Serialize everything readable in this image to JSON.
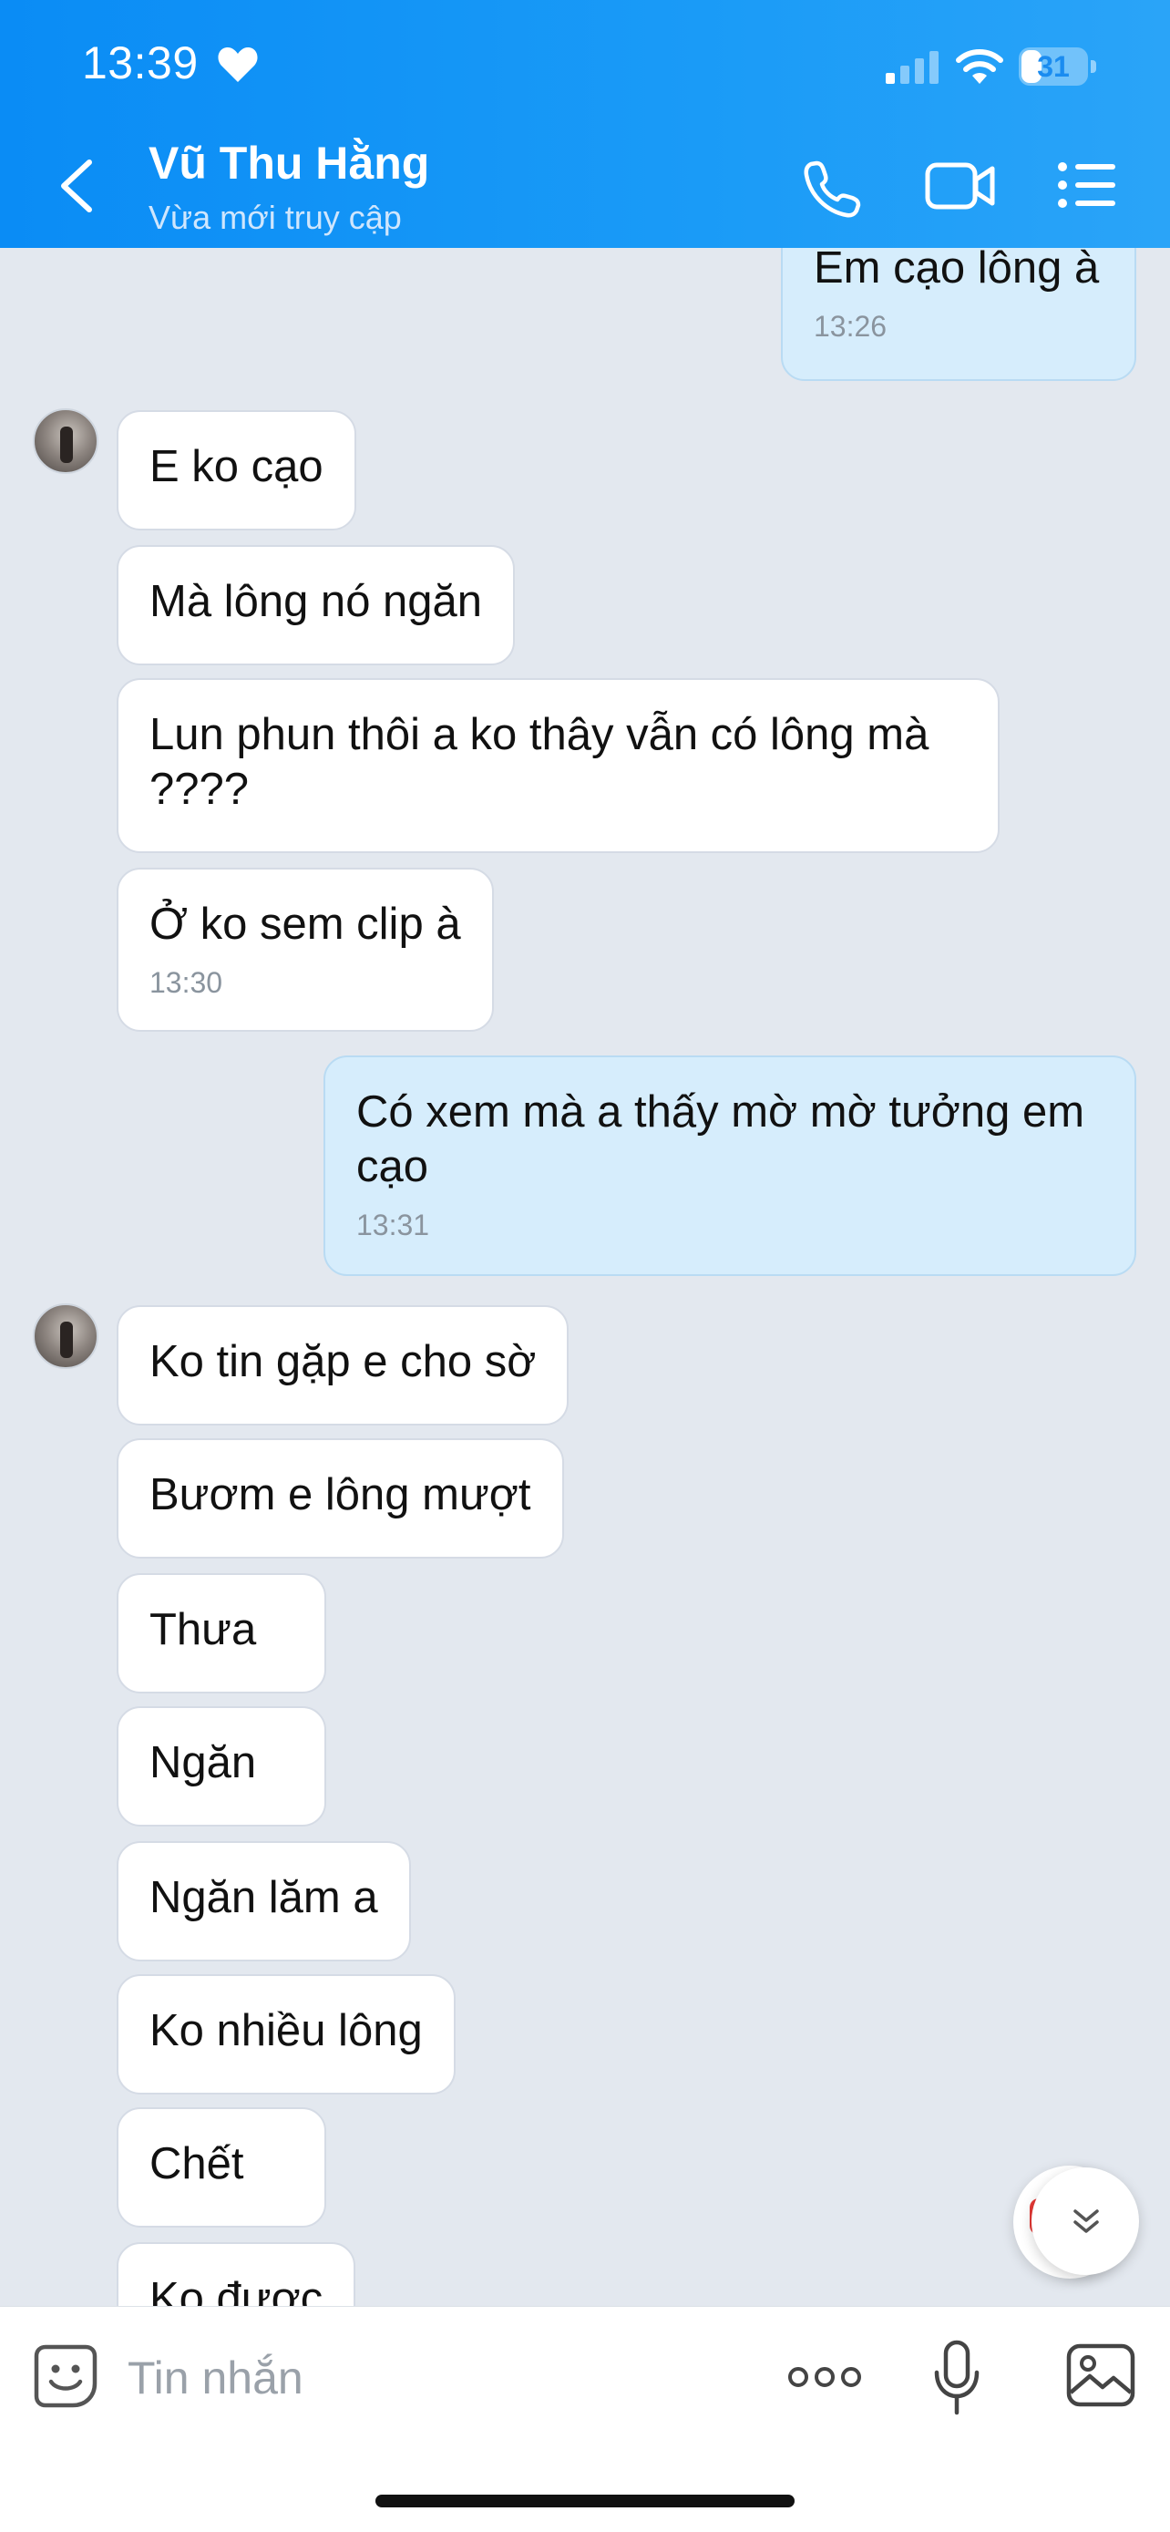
{
  "status_bar": {
    "time": "13:39",
    "battery": "31",
    "battery_level": 0.31
  },
  "header": {
    "contact_name": "Vũ Thu Hằng",
    "contact_status": "Vừa mới truy cập"
  },
  "messages": [
    {
      "text": "Em cạo lông à",
      "time": "13:26",
      "direction": "out"
    },
    {
      "text": "E ko cạo",
      "direction": "in"
    },
    {
      "text": "Mà lông nó ngăn",
      "direction": "in"
    },
    {
      "text": "Lun phun thôi a ko thây vẫn có lông mà ????",
      "direction": "in"
    },
    {
      "text": "Ở ko sem clip à",
      "time": "13:30",
      "direction": "in"
    },
    {
      "text": "Có xem mà a thấy mờ mờ tưởng em cạo",
      "time": "13:31",
      "direction": "out"
    },
    {
      "text": "Ko tin gặp e cho sờ",
      "direction": "in"
    },
    {
      "text": "Bươm e lông mượt",
      "direction": "in"
    },
    {
      "text": "Thưa",
      "direction": "in"
    },
    {
      "text": "Ngăn",
      "direction": "in"
    },
    {
      "text": "Ngăn lăm a",
      "direction": "in"
    },
    {
      "text": "Ko nhiều lông",
      "direction": "in"
    },
    {
      "text": "Chết",
      "direction": "in"
    },
    {
      "text": "Ko được",
      "direction": "in"
    }
  ],
  "composer": {
    "placeholder": "Tin nhắn"
  },
  "icons": {
    "back": "chevron-left-icon",
    "call": "phone-icon",
    "video": "video-camera-icon",
    "menu": "list-menu-icon",
    "emoji": "emoji-sticker-icon",
    "more": "more-dots-icon",
    "mic": "microphone-icon",
    "image": "image-gallery-icon",
    "scroll": "chevron-double-down-icon"
  },
  "colors": {
    "header": "#0a8cf5",
    "outgoing_bubble": "#d6edfc",
    "incoming_bubble": "#ffffff",
    "chat_bg": "#e3e8ef"
  }
}
